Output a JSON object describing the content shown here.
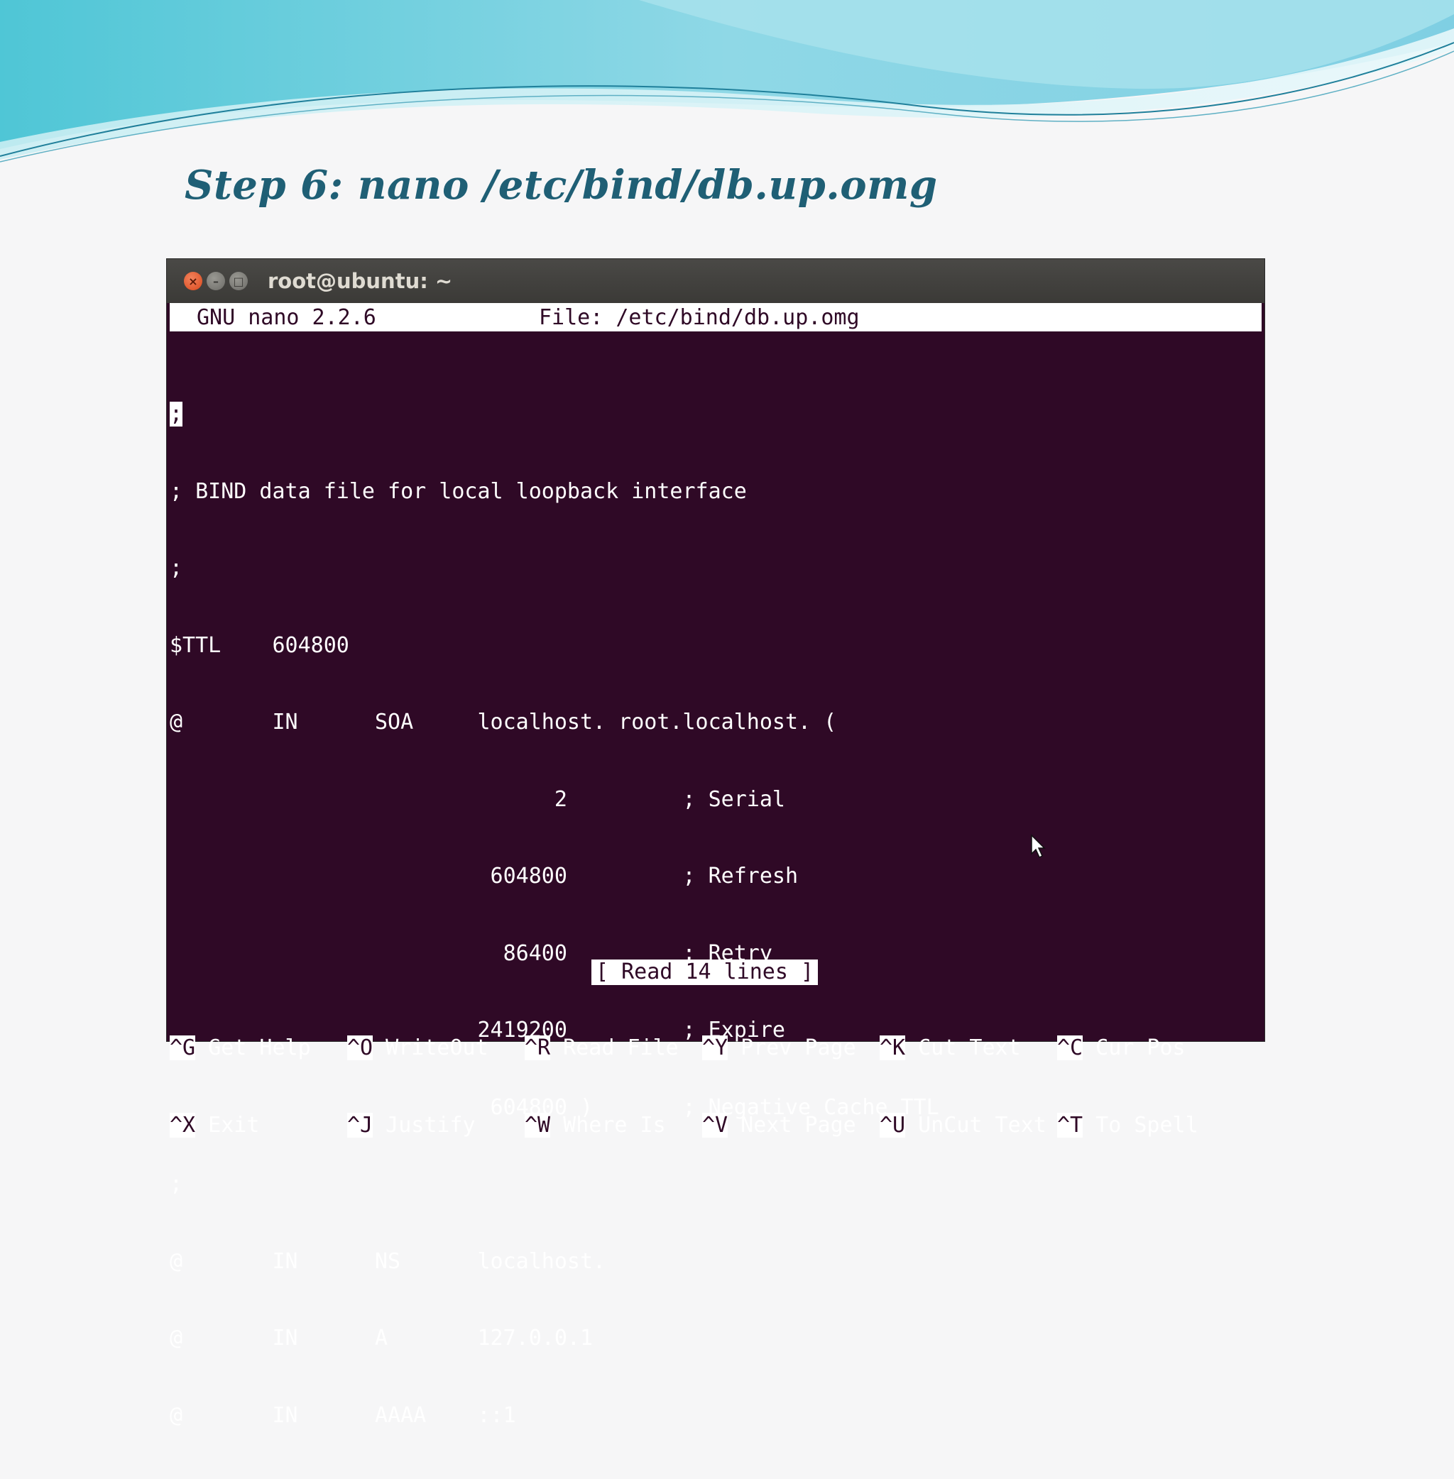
{
  "slide": {
    "title": "Step 6:  nano /etc/bind/db.up.omg"
  },
  "window": {
    "title": "root@ubuntu: ~",
    "buttons": [
      "close-icon",
      "minimize-icon",
      "maximize-icon"
    ]
  },
  "nano": {
    "version": "GNU nano 2.2.6",
    "file": "File: /etc/bind/db.up.omg",
    "lines": [
      ";",
      "; BIND data file for local loopback interface",
      ";",
      "$TTL    604800",
      "@       IN      SOA     localhost. root.localhost. (",
      "                              2         ; Serial",
      "                         604800         ; Refresh",
      "                          86400         ; Retry",
      "                        2419200         ; Expire",
      "                         604800 )       ; Negative Cache TTL",
      ";",
      "@       IN      NS      localhost.",
      "@       IN      A       127.0.0.1",
      "@       IN      AAAA    ::1"
    ],
    "status": "[ Read 14 lines ]",
    "shortcuts": [
      [
        {
          "key": "^G",
          "label": " Get Help"
        },
        {
          "key": "^O",
          "label": " WriteOut"
        },
        {
          "key": "^R",
          "label": " Read File"
        },
        {
          "key": "^Y",
          "label": " Prev Page"
        },
        {
          "key": "^K",
          "label": " Cut Text"
        },
        {
          "key": "^C",
          "label": " Cur Pos"
        }
      ],
      [
        {
          "key": "^X",
          "label": " Exit"
        },
        {
          "key": "^J",
          "label": " Justify"
        },
        {
          "key": "^W",
          "label": " Where Is"
        },
        {
          "key": "^V",
          "label": " Next Page"
        },
        {
          "key": "^U",
          "label": " UnCut Text"
        },
        {
          "key": "^T",
          "label": " To Spell"
        }
      ]
    ]
  },
  "colors": {
    "terminal_bg": "#2f0926",
    "title_color": "#1f5f75",
    "close_button": "#e0552b"
  }
}
